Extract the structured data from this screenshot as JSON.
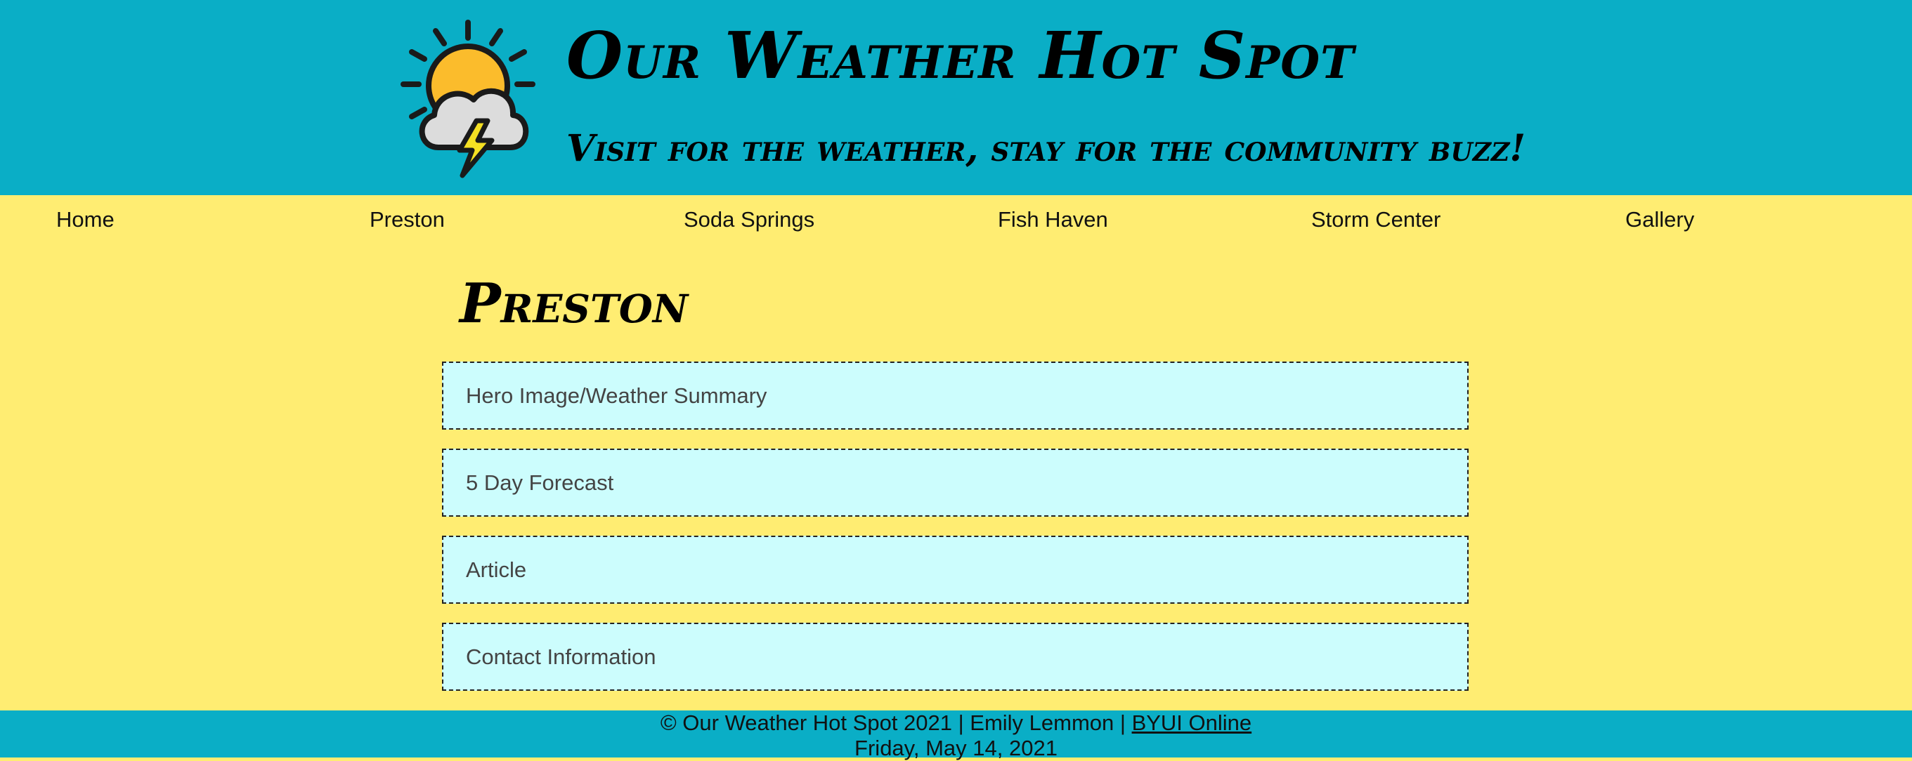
{
  "header": {
    "logo_icon": "sun-cloud-lightning-icon",
    "title": "Our Weather Hot Spot",
    "tagline": "Visit for the weather, stay for the community buzz!"
  },
  "nav": {
    "items": [
      {
        "label": "Home"
      },
      {
        "label": "Preston"
      },
      {
        "label": "Soda Springs"
      },
      {
        "label": "Fish Haven"
      },
      {
        "label": "Storm Center"
      },
      {
        "label": "Gallery"
      }
    ]
  },
  "main": {
    "title": "Preston",
    "sections": [
      {
        "label": "Hero Image/Weather Summary"
      },
      {
        "label": "5 Day Forecast"
      },
      {
        "label": "Article"
      },
      {
        "label": "Contact Information"
      }
    ]
  },
  "footer": {
    "copyright": "© Our Weather Hot Spot 2021 | Emily Lemmon | ",
    "link_text": "BYUI Online",
    "date": "Friday, May 14, 2021"
  },
  "colors": {
    "header_bg": "#0aaec6",
    "page_bg": "#ffed72",
    "section_bg": "#ccfdfd",
    "sun": "#fbbc2c",
    "cloud": "#dcdcdc",
    "lightning": "#f5e023"
  }
}
